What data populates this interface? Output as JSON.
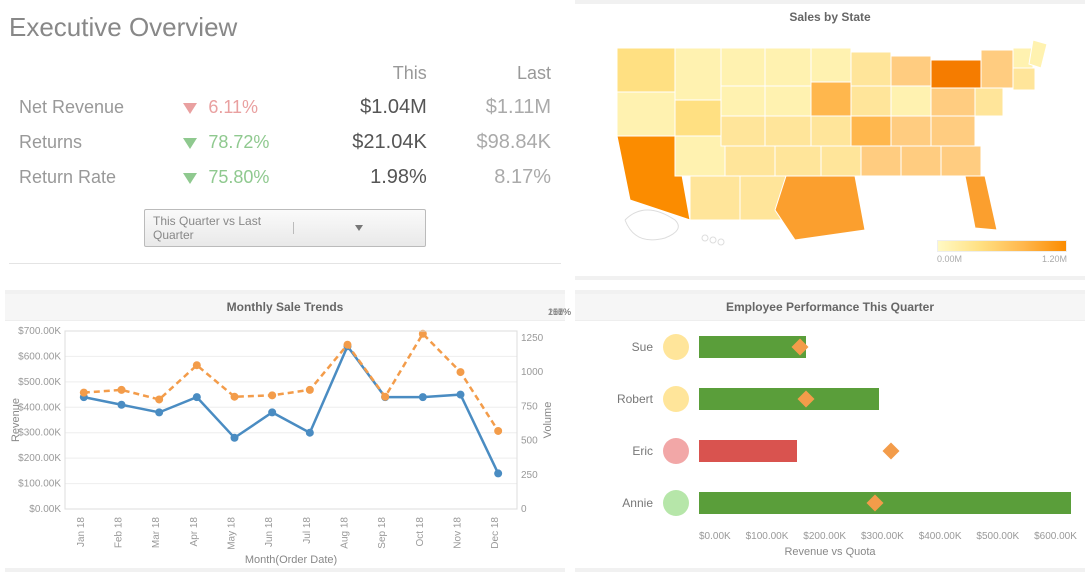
{
  "header": {
    "title": "Executive Overview"
  },
  "kpi": {
    "col_this": "This",
    "col_last": "Last",
    "rows": [
      {
        "label": "Net Revenue",
        "dir": "down",
        "color": "red",
        "chg": "6.11%",
        "this": "$1.04M",
        "last": "$1.11M"
      },
      {
        "label": "Returns",
        "dir": "down",
        "color": "green",
        "chg": "78.72%",
        "this": "$21.04K",
        "last": "$98.84K"
      },
      {
        "label": "Return Rate",
        "dir": "down",
        "color": "green",
        "chg": "75.80%",
        "this": "1.98%",
        "last": "8.17%"
      }
    ],
    "selector": {
      "value": "This Quarter vs Last Quarter"
    }
  },
  "map": {
    "title": "Sales by State",
    "legend_min": "0.00M",
    "legend_max": "1.20M"
  },
  "trends": {
    "title": "Monthly Sale Trends",
    "xlabel": "Month(Order Date)",
    "ylabel_left": "Revenue",
    "ylabel_right": "Volume"
  },
  "emp": {
    "title": "Employee Performance This Quarter",
    "xlabel": "Revenue vs Quota",
    "axis": [
      "$0.00K",
      "$100.00K",
      "$200.00K",
      "$300.00K",
      "$400.00K",
      "$500.00K",
      "$600.00K"
    ],
    "max": 600,
    "rows": [
      {
        "name": "Sue",
        "pct": "107%",
        "value": 170,
        "quota": 160,
        "dot": "#ffe59a",
        "bar": "#5a9e3a"
      },
      {
        "name": "Robert",
        "pct": "168%",
        "value": 285,
        "quota": 170,
        "dot": "#ffe59a",
        "bar": "#5a9e3a"
      },
      {
        "name": "Eric",
        "pct": "51%",
        "value": 155,
        "quota": 305,
        "dot": "#f2a7a7",
        "bar": "#d9534f"
      },
      {
        "name": "Annie",
        "pct": "210%",
        "value": 590,
        "quota": 280,
        "dot": "#b6e6a9",
        "bar": "#5a9e3a"
      }
    ]
  },
  "chart_data": [
    {
      "type": "line",
      "title": "Monthly Sale Trends",
      "xlabel": "Month(Order Date)",
      "categories": [
        "Jan 18",
        "Feb 18",
        "Mar 18",
        "Apr 18",
        "May 18",
        "Jun 18",
        "Jul 18",
        "Aug 18",
        "Sep 18",
        "Oct 18",
        "Nov 18",
        "Dec 18"
      ],
      "series": [
        {
          "name": "Revenue",
          "axis": "left",
          "style": "solid",
          "color": "#4a8cc2",
          "values": [
            440000,
            410000,
            380000,
            440000,
            280000,
            380000,
            300000,
            640000,
            440000,
            440000,
            450000,
            140000
          ]
        },
        {
          "name": "Volume",
          "axis": "right",
          "style": "dashed",
          "color": "#f39c4a",
          "values": [
            850,
            870,
            800,
            1050,
            820,
            830,
            870,
            1200,
            820,
            1280,
            1000,
            570
          ]
        }
      ],
      "y_left": {
        "label": "Revenue",
        "min": 0,
        "max": 700000,
        "ticks": [
          "$0.00K",
          "$100.00K",
          "$200.00K",
          "$300.00K",
          "$400.00K",
          "$500.00K",
          "$600.00K",
          "$700.00K"
        ]
      },
      "y_right": {
        "label": "Volume",
        "min": 0,
        "max": 1300,
        "ticks": [
          0,
          250,
          500,
          750,
          1000,
          1250
        ]
      }
    },
    {
      "type": "bar",
      "title": "Employee Performance This Quarter",
      "xlabel": "Revenue vs Quota",
      "categories": [
        "Sue",
        "Robert",
        "Eric",
        "Annie"
      ],
      "series": [
        {
          "name": "Revenue",
          "values": [
            170,
            285,
            155,
            590
          ],
          "unit": "K"
        },
        {
          "name": "Quota",
          "values": [
            160,
            170,
            305,
            280
          ],
          "unit": "K",
          "marker": "diamond"
        }
      ],
      "pct_of_quota": [
        107,
        168,
        51,
        210
      ],
      "x": {
        "min": 0,
        "max": 600,
        "ticks": [
          "$0.00K",
          "$100.00K",
          "$200.00K",
          "$300.00K",
          "$400.00K",
          "$500.00K",
          "$600.00K"
        ]
      }
    },
    {
      "type": "heatmap",
      "title": "Sales by State",
      "unit": "M",
      "color_scale": {
        "min": 0.0,
        "max": 1.2,
        "palette": [
          "#fff9c4",
          "#ffe082",
          "#ffb74d",
          "#fb8c00"
        ]
      },
      "note": "US choropleth; highest states approx CA, TX, PA, FL"
    }
  ]
}
